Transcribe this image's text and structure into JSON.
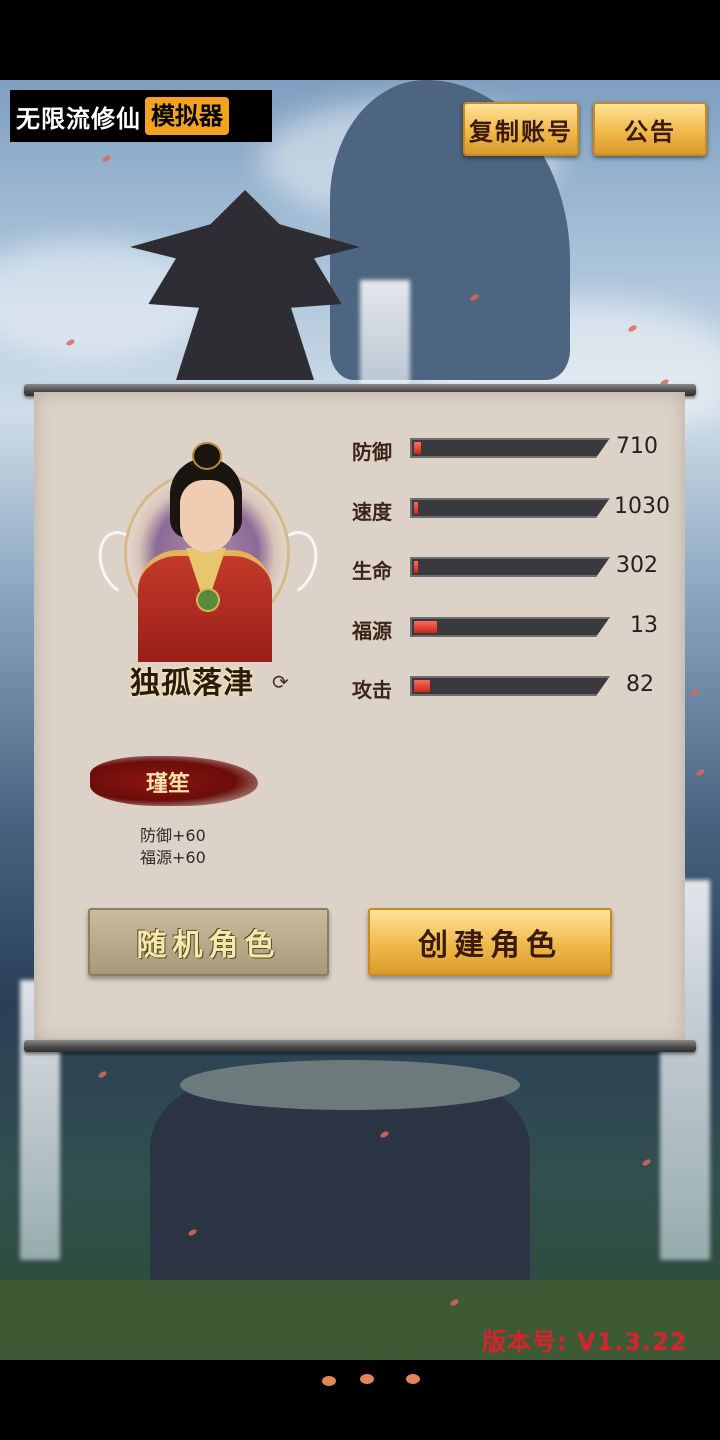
{
  "header": {
    "logo_text": "无限流修仙",
    "logo_tag": "模拟器",
    "copy_account_label": "复制账号",
    "notice_label": "公告"
  },
  "character": {
    "name": "独孤落津",
    "refresh_icon": "refresh-icon"
  },
  "stats": [
    {
      "label": "防御",
      "value": "710",
      "fill": 0.04
    },
    {
      "label": "速度",
      "value": "1030",
      "fill": 0.0
    },
    {
      "label": "生命",
      "value": "302",
      "fill": 0.02
    },
    {
      "label": "福源",
      "value": "13",
      "fill": 0.13
    },
    {
      "label": "攻击",
      "value": "82",
      "fill": 0.09
    }
  ],
  "trait": {
    "name": "瑾笙",
    "effects": [
      "防御+60",
      "福源+60"
    ]
  },
  "actions": {
    "random_label": "随机角色",
    "create_label": "创建角色"
  },
  "footer": {
    "version": "版本号: V1.3.22"
  },
  "colors": {
    "accent_gold": "#f0b94a",
    "bar_fill": "#e0382a",
    "version_red": "#d8232e"
  }
}
